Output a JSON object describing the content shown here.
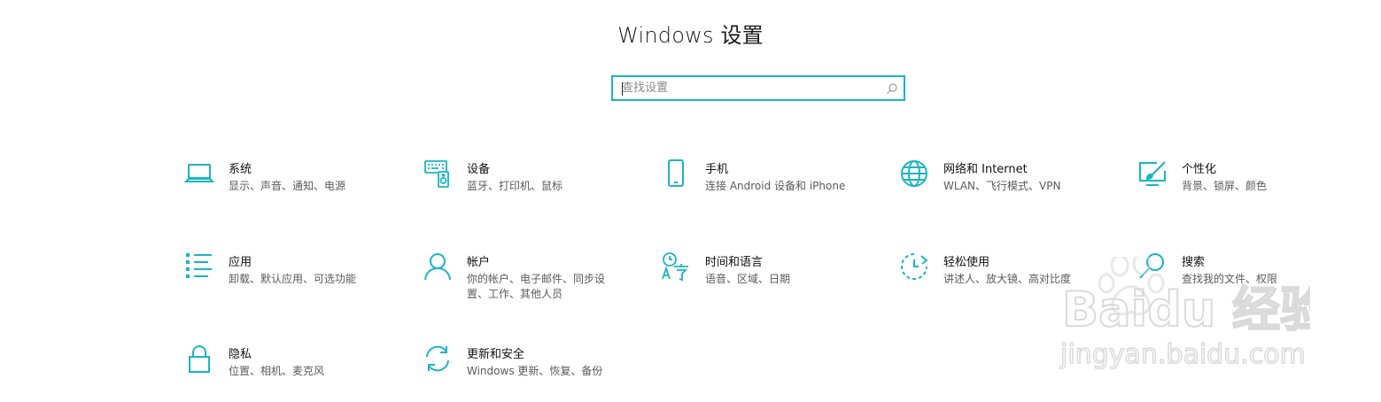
{
  "window": {
    "title": "Windows 设置"
  },
  "search": {
    "placeholder": "查找设置"
  },
  "tiles": [
    {
      "name": "系统",
      "desc": "显示、声音、通知、电源",
      "icon": "laptop-icon"
    },
    {
      "name": "设备",
      "desc": "蓝牙、打印机、鼠标",
      "icon": "keyboard-speaker-icon"
    },
    {
      "name": "手机",
      "desc": "连接 Android 设备和 iPhone",
      "icon": "phone-icon"
    },
    {
      "name": "网络和 Internet",
      "desc": "WLAN、飞行模式、VPN",
      "icon": "globe-icon"
    },
    {
      "name": "个性化",
      "desc": "背景、锁屏、颜色",
      "icon": "paintbrush-icon"
    },
    {
      "name": "应用",
      "desc": "卸载、默认应用、可选功能",
      "icon": "apps-list-icon"
    },
    {
      "name": "帐户",
      "desc": "你的帐户、电子邮件、同步设置、工作、其他人员",
      "icon": "person-icon"
    },
    {
      "name": "时间和语言",
      "desc": "语音、区域、日期",
      "icon": "time-language-icon"
    },
    {
      "name": "轻松使用",
      "desc": "讲述人、放大镜、高对比度",
      "icon": "ease-of-access-icon"
    },
    {
      "name": "搜索",
      "desc": "查找我的文件、权限",
      "icon": "search-icon"
    },
    {
      "name": "隐私",
      "desc": "位置、相机、麦克风",
      "icon": "lock-icon"
    },
    {
      "name": "更新和安全",
      "desc": "Windows 更新、恢复、备份",
      "icon": "sync-icon"
    }
  ],
  "watermark": {
    "brand": "Baidu 经验",
    "url": "jingyan.baidu.com"
  },
  "colors": {
    "accent": "#1ab5c2",
    "title": "#1a1a1a",
    "desc": "#5a5a5a"
  }
}
